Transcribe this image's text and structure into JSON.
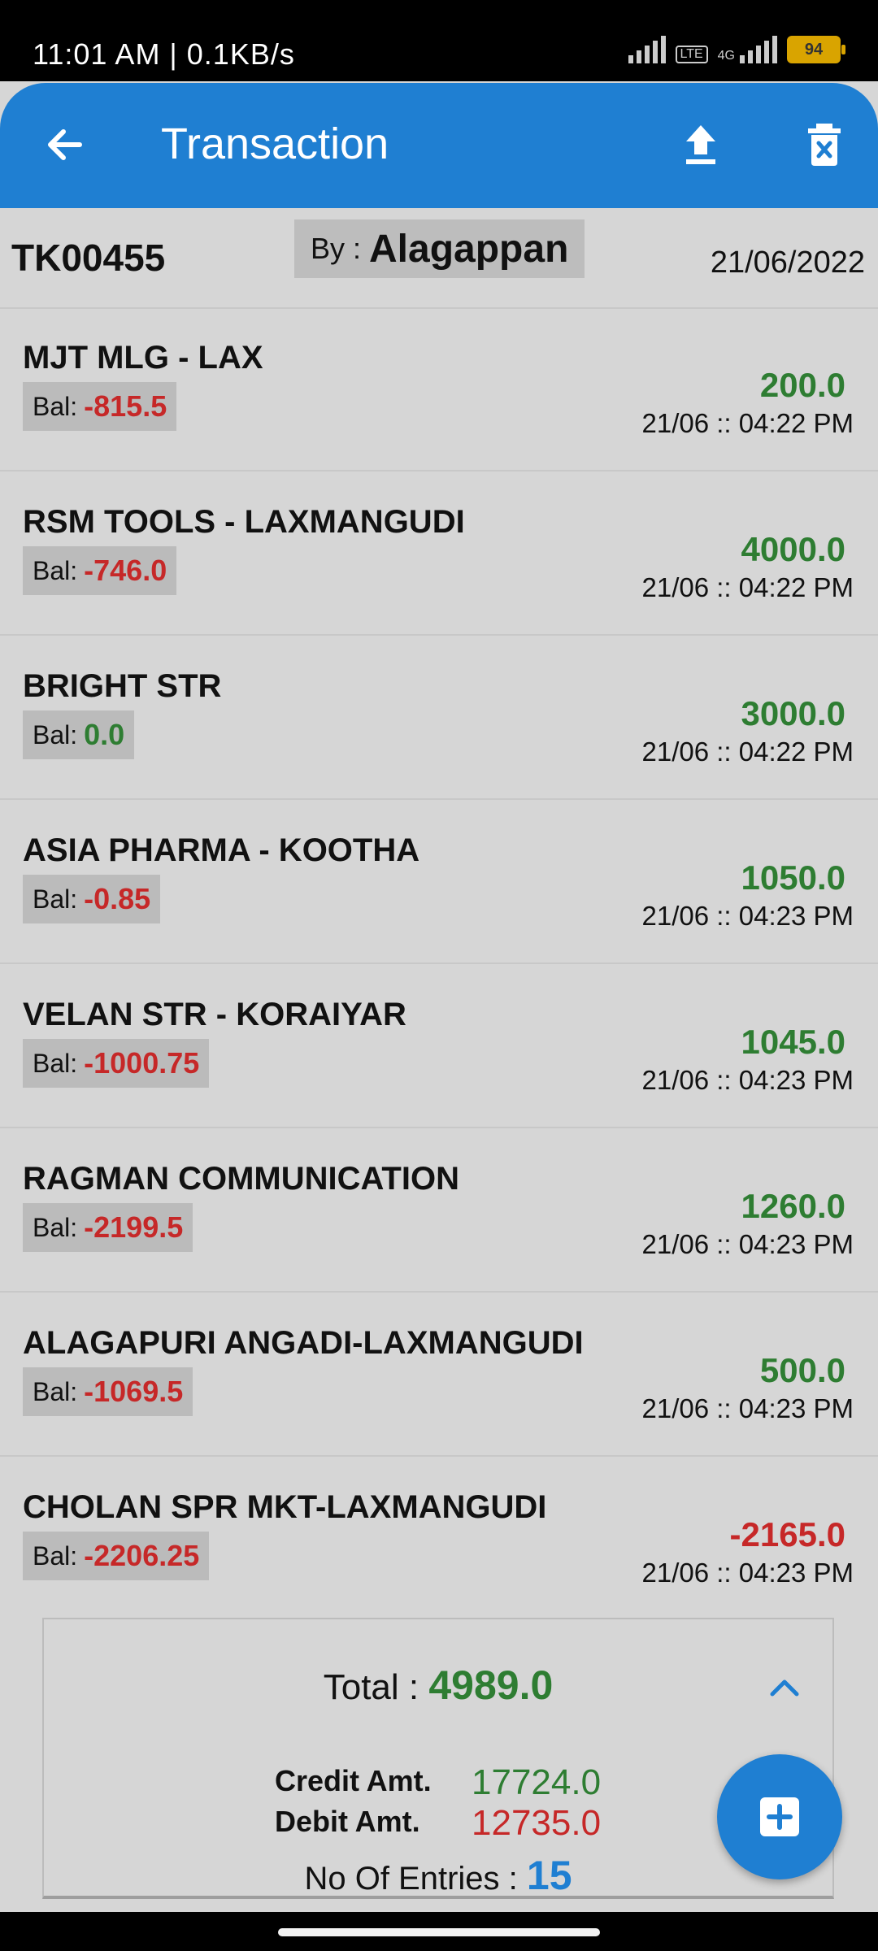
{
  "status_bar": {
    "time": "11:01 AM | 0.1KB/s",
    "battery": "94",
    "net": "4G",
    "volte": "VoLTE"
  },
  "app_bar": {
    "title": "Transaction",
    "icons": [
      "arrow-left-icon",
      "upload-icon",
      "trash-x-icon"
    ],
    "color": "#1f7fd2"
  },
  "header": {
    "code": "TK00455",
    "by_label": "By :",
    "by_name": "Alagappan",
    "date": "21/06/2022"
  },
  "transactions": [
    {
      "name": "MJT MLG - LAX",
      "bal_label": "Bal:",
      "bal": "-815.5",
      "bal_status": "negative",
      "amount": "200.0",
      "amount_status": "positive",
      "time": "21/06 :: 04:22 PM"
    },
    {
      "name": "RSM TOOLS - LAXMANGUDI",
      "bal_label": "Bal:",
      "bal": "-746.0",
      "bal_status": "negative",
      "amount": "4000.0",
      "amount_status": "positive",
      "time": "21/06 :: 04:22 PM"
    },
    {
      "name": "BRIGHT STR",
      "bal_label": "Bal:",
      "bal": "0.0",
      "bal_status": "positive",
      "amount": "3000.0",
      "amount_status": "positive",
      "time": "21/06 :: 04:22 PM"
    },
    {
      "name": "ASIA PHARMA - KOOTHA",
      "bal_label": "Bal:",
      "bal": "-0.85",
      "bal_status": "negative",
      "amount": "1050.0",
      "amount_status": "positive",
      "time": "21/06 :: 04:23 PM"
    },
    {
      "name": "VELAN STR - KORAIYAR",
      "bal_label": "Bal:",
      "bal": "-1000.75",
      "bal_status": "negative",
      "amount": "1045.0",
      "amount_status": "positive",
      "time": "21/06 :: 04:23 PM"
    },
    {
      "name": "RAGMAN COMMUNICATION",
      "bal_label": "Bal:",
      "bal": "-2199.5",
      "bal_status": "negative",
      "amount": "1260.0",
      "amount_status": "positive",
      "time": "21/06 :: 04:23 PM"
    },
    {
      "name": "ALAGAPURI ANGADI-LAXMANGUDI",
      "bal_label": "Bal:",
      "bal": "-1069.5",
      "bal_status": "negative",
      "amount": "500.0",
      "amount_status": "positive",
      "time": "21/06 :: 04:23 PM"
    },
    {
      "name": "CHOLAN SPR MKT-LAXMANGUDI",
      "bal_label": "Bal:",
      "bal": "-2206.25",
      "bal_status": "negative",
      "amount": "-2165.0",
      "amount_status": "negative",
      "time": "21/06 :: 04:23 PM"
    }
  ],
  "summary": {
    "total_label": "Total :",
    "total": "4989.0",
    "credit_label": "Credit Amt.",
    "credit": "17724.0",
    "debit_label": "Debit Amt.",
    "debit": "12735.0",
    "entries_label": "No Of Entries :",
    "entries": "15"
  },
  "colors": {
    "positive": "#2e7d32",
    "negative": "#c62828",
    "accent": "#1f7fd2"
  }
}
